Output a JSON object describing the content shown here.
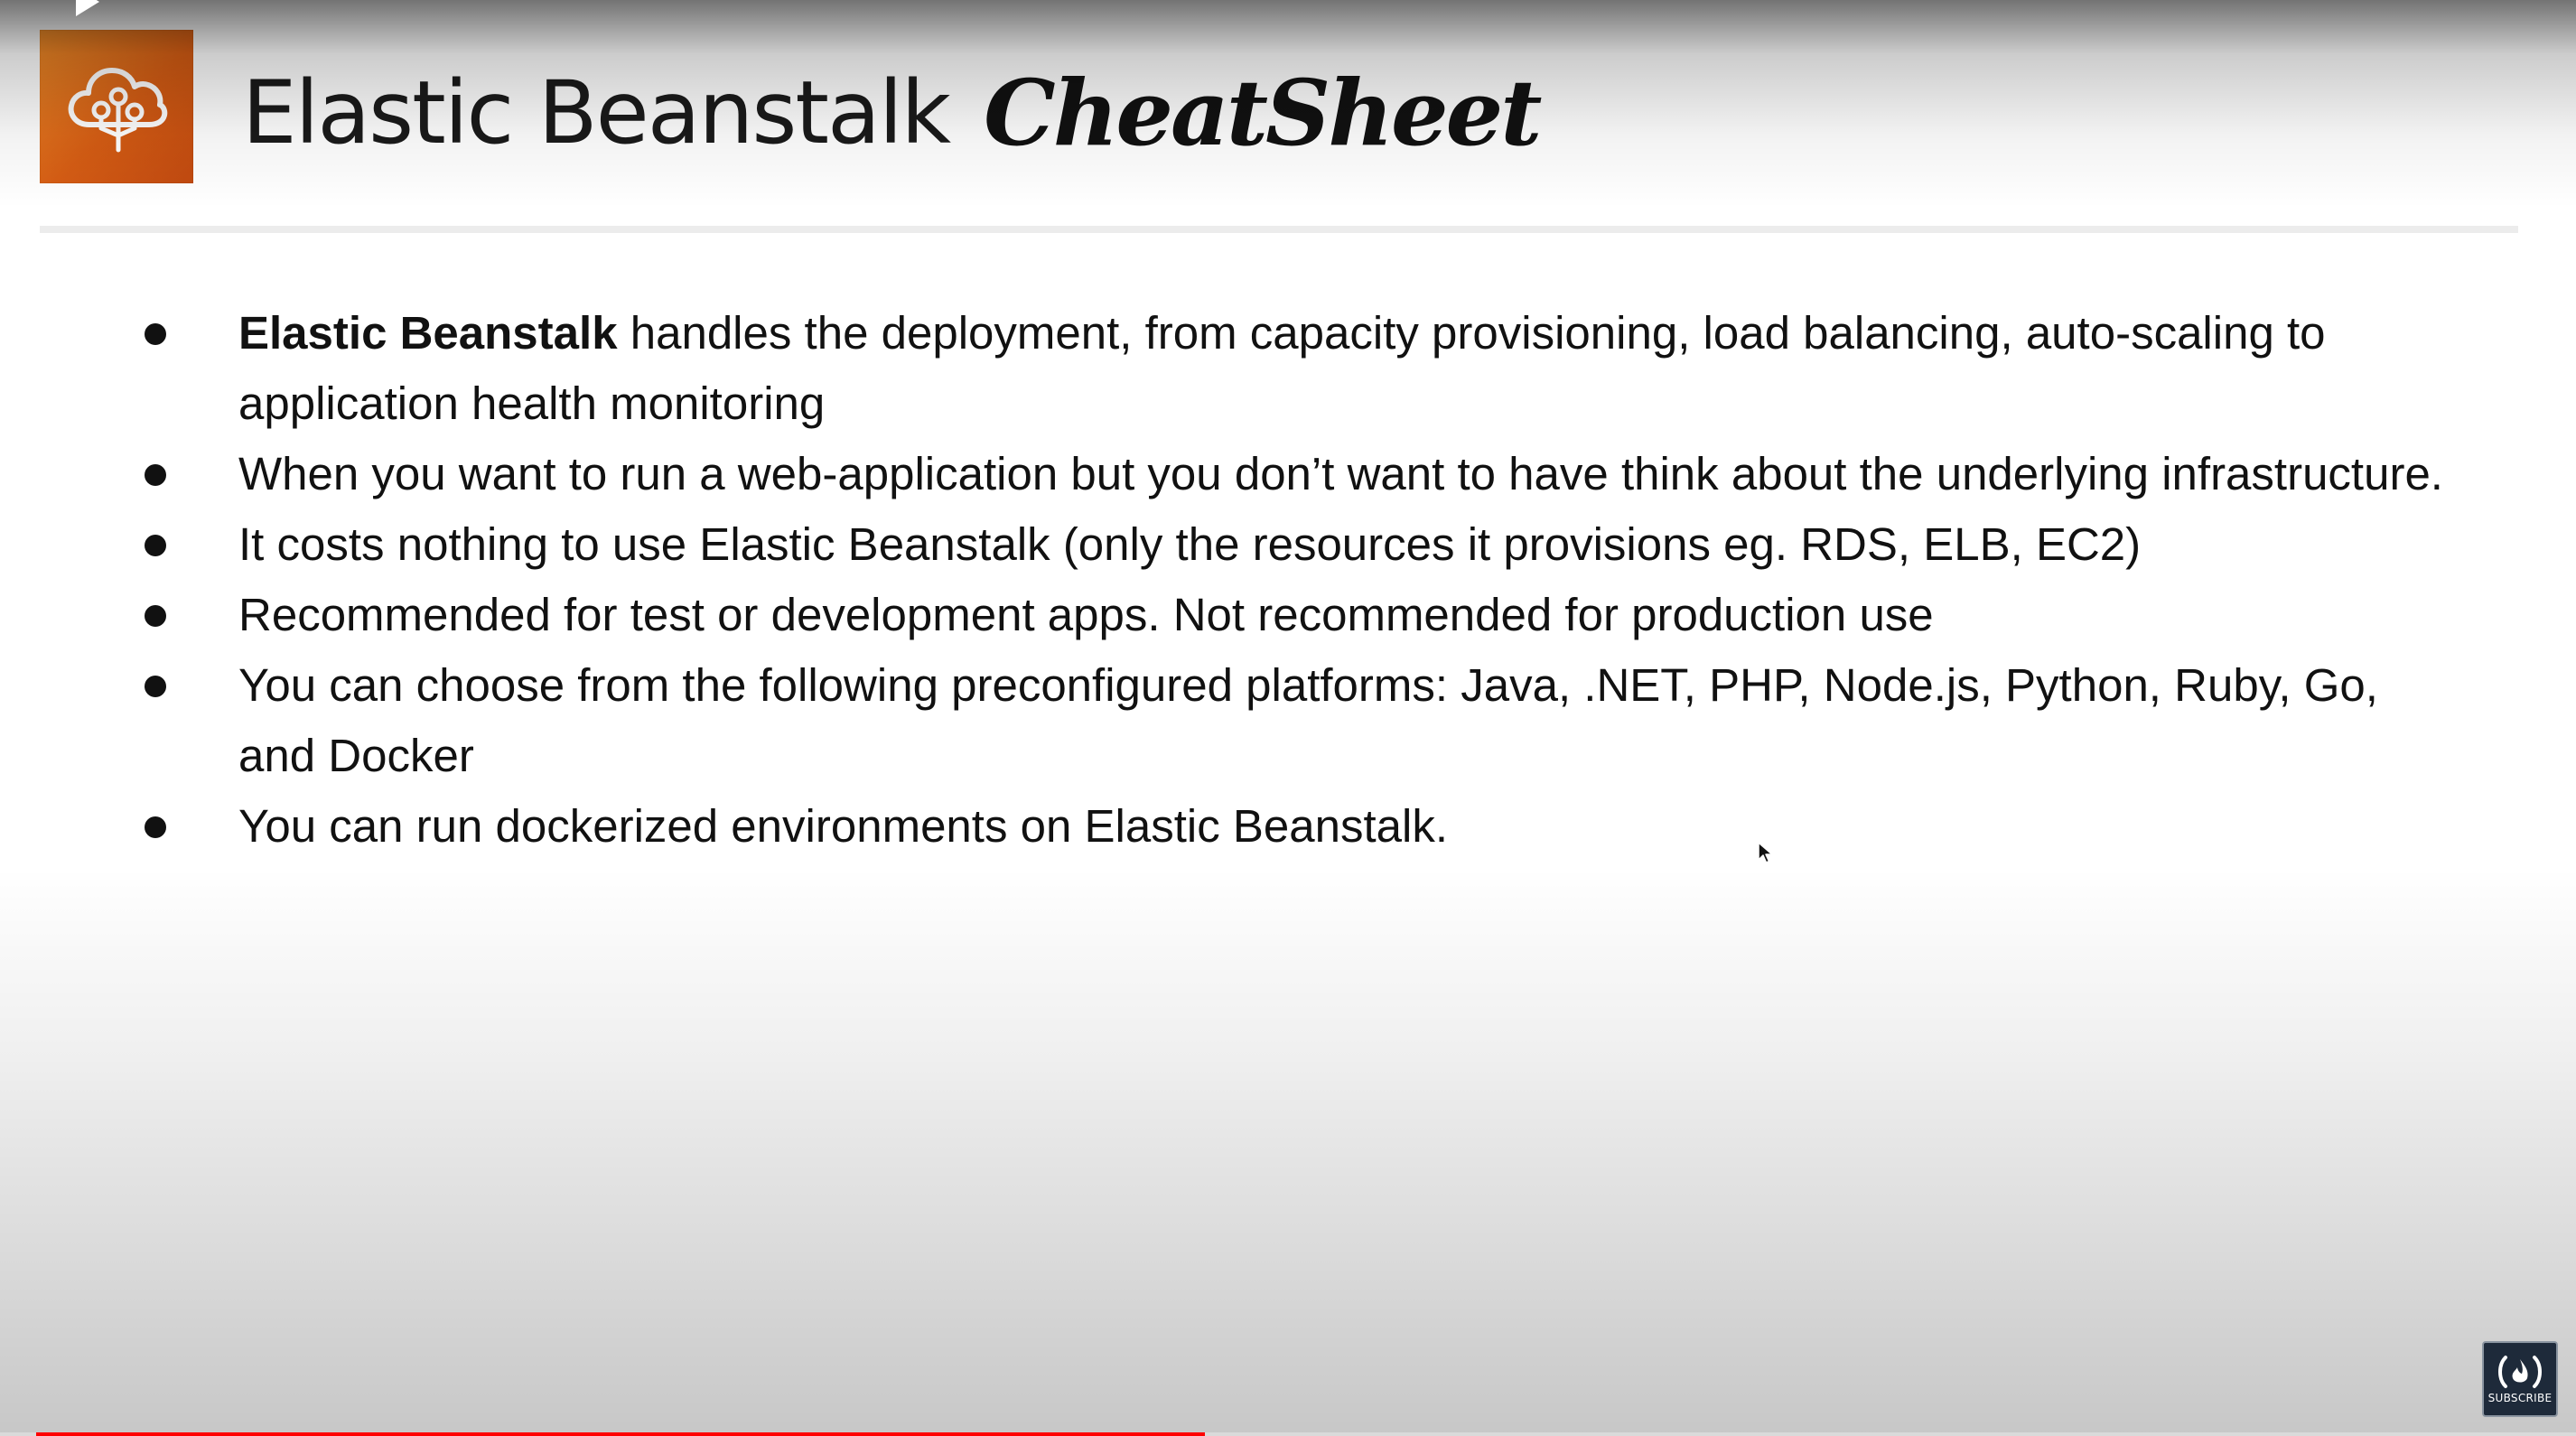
{
  "slide": {
    "title": "Elastic Beanstalk",
    "title_script": "CheatSheet",
    "logo_icon": "elastic-beanstalk-cloud-tree-icon",
    "logo_colors": [
      "#f08c28",
      "#c24a10"
    ],
    "bullets": [
      {
        "bold": "Elastic Beanstalk",
        "text": " handles the deployment, from capacity provisioning, load balancing, auto-scaling to application health monitoring"
      },
      {
        "bold": "",
        "text": "When you want to run a web-application but you don’t want to have think about the underlying infrastructure."
      },
      {
        "bold": "",
        "text": "It costs nothing to use Elastic Beanstalk (only the resources it provisions eg. RDS, ELB, EC2)"
      },
      {
        "bold": "",
        "text": "Recommended for test or development apps. Not recommended for production use"
      },
      {
        "bold": "",
        "text": "You can choose from the following preconfigured platforms: Java, .NET, PHP, Node.js, Python, Ruby, Go, and Docker"
      },
      {
        "bold": "",
        "text": "You can run dockerized environments on Elastic Beanstalk."
      }
    ]
  },
  "player": {
    "subscribe_label": "SUBSCRIBE",
    "subscribe_icon": "freecodecamp-flame-icon",
    "progress_fraction": 0.46,
    "progress_color": "#ff0000"
  }
}
